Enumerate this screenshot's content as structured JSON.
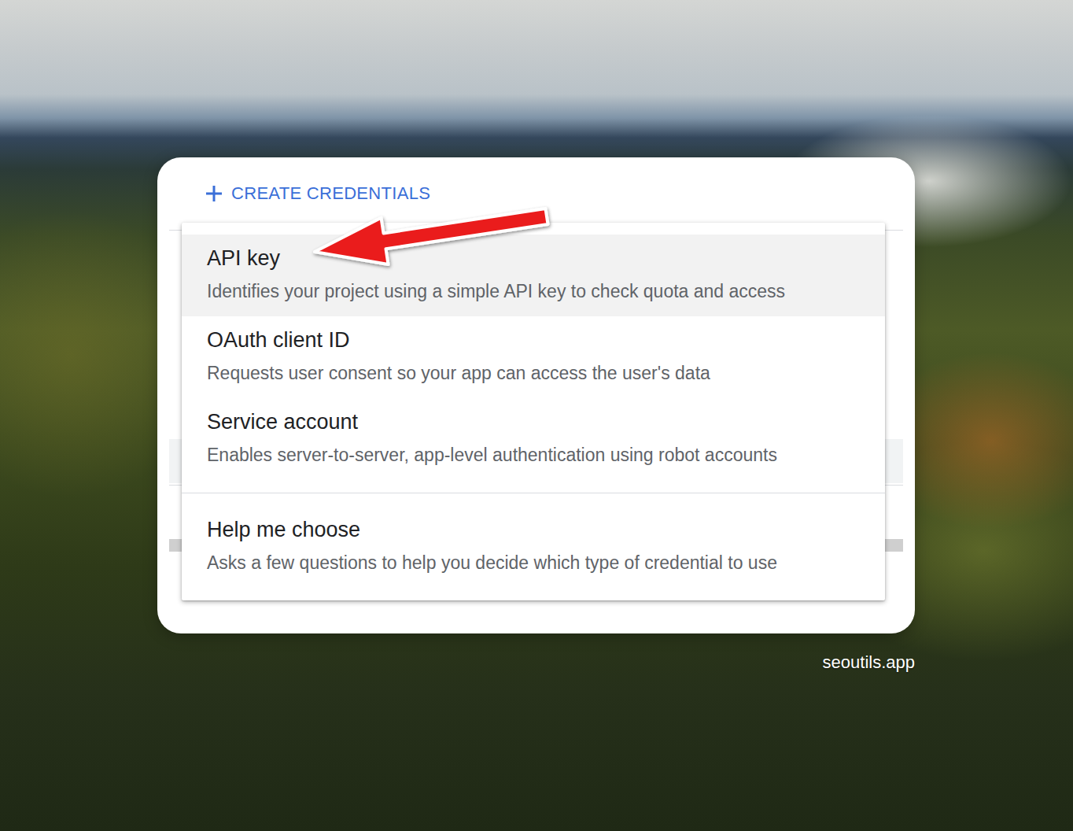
{
  "header": {
    "button": "CREATE CREDENTIALS"
  },
  "menu": {
    "groups": [
      {
        "items": [
          {
            "title": "API key",
            "description": "Identifies your project using a simple API key to check quota and access",
            "selected": true
          },
          {
            "title": "OAuth client ID",
            "description": "Requests user consent so your app can access the user's data",
            "selected": false
          },
          {
            "title": "Service account",
            "description": "Enables server-to-server, app-level authentication using robot accounts",
            "selected": false
          }
        ]
      },
      {
        "items": [
          {
            "title": "Help me choose",
            "description": "Asks a few questions to help you decide which type of credential to use",
            "selected": false
          }
        ]
      }
    ]
  },
  "watermark": "seoutils.app"
}
